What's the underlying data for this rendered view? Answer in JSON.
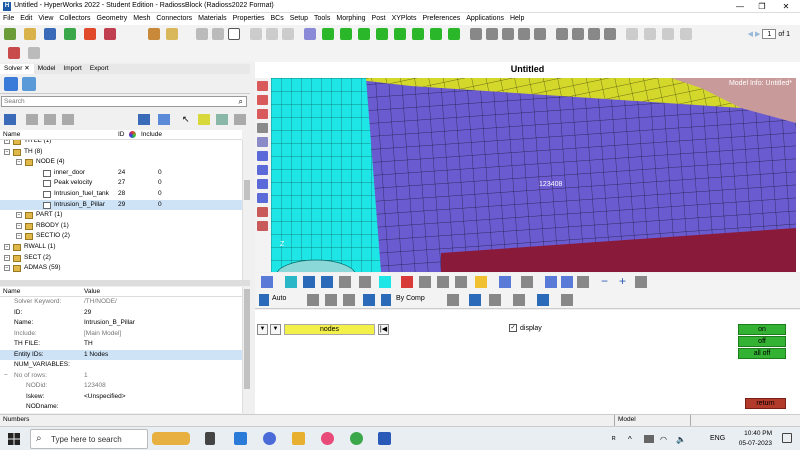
{
  "window": {
    "title": "Untitled - HyperWorks 2022 - Student Edition - RadiossBlock (Radioss2022 Format)",
    "minimize": "—",
    "maximize": "❐",
    "close": "✕"
  },
  "menu": [
    "File",
    "Edit",
    "View",
    "Collectors",
    "Geometry",
    "Mesh",
    "Connectors",
    "Materials",
    "Properties",
    "BCs",
    "Setup",
    "Tools",
    "Morphing",
    "Post",
    "XYPlots",
    "Preferences",
    "Applications",
    "Help"
  ],
  "toolbar": {
    "page_current": "1",
    "page_total_label": "of 1"
  },
  "left_tabs": [
    "Solver ✕",
    "Model",
    "Import",
    "Export"
  ],
  "search": {
    "placeholder": "Search"
  },
  "tree": {
    "headers": {
      "name": "Name",
      "id": "ID",
      "include": "Include"
    },
    "rows": [
      {
        "label": "TITLE (1)",
        "id": "",
        "include": ""
      },
      {
        "label": "TH (8)",
        "id": "",
        "include": ""
      },
      {
        "label": "NODE (4)",
        "id": "",
        "include": ""
      },
      {
        "label": "inner_door",
        "id": "24",
        "include": "0"
      },
      {
        "label": "Peak velocity",
        "id": "27",
        "include": "0"
      },
      {
        "label": "Intrusion_fuel_tank",
        "id": "28",
        "include": "0"
      },
      {
        "label": "Intrusion_B_Pillar",
        "id": "29",
        "include": "0"
      },
      {
        "label": "PART (1)",
        "id": "",
        "include": ""
      },
      {
        "label": "RBODY (1)",
        "id": "",
        "include": ""
      },
      {
        "label": "SECTIO (2)",
        "id": "",
        "include": ""
      },
      {
        "label": "RWALL (1)",
        "id": "",
        "include": ""
      },
      {
        "label": "SECT (2)",
        "id": "",
        "include": ""
      },
      {
        "label": "ADMAS (59)",
        "id": "",
        "include": ""
      }
    ]
  },
  "props": {
    "headers": {
      "name": "Name",
      "value": "Value"
    },
    "rows": [
      {
        "key": "Solver Keyword:",
        "value": "/TH/NODE/"
      },
      {
        "key": "ID:",
        "value": "29"
      },
      {
        "key": "Name:",
        "value": "Intrusion_B_Pillar"
      },
      {
        "key": "Include:",
        "value": "[Main Model]"
      },
      {
        "key": "TH FILE:",
        "value": "TH"
      },
      {
        "key": "Entity IDs:",
        "value": "1 Nodes"
      },
      {
        "key": "NUM_VARIABLES:",
        "value": ""
      },
      {
        "key": "No of rows:",
        "value": "1"
      },
      {
        "key": "NODid:",
        "value": "123408"
      },
      {
        "key": "Iskew:",
        "value": "<Unspecified>"
      },
      {
        "key": "NODname:",
        "value": ""
      }
    ]
  },
  "viewport": {
    "title": "Untitled",
    "model_info": "Model Info: Untitled*",
    "node_label": "123408"
  },
  "toolbar_lower": {
    "auto_label": "Auto",
    "bycomp_label": "By Comp"
  },
  "panel": {
    "nodes_label": "nodes",
    "display_label": "display",
    "on_label": "on",
    "off_label": "off",
    "alloff_label": "all off",
    "return_label": "return"
  },
  "status": {
    "left": "Numbers",
    "model": "Model"
  },
  "taskbar": {
    "search_placeholder": "Type here to search",
    "lang": "ENG",
    "time": "10:40 PM",
    "date": "05-07-2023"
  },
  "colors": {
    "mesh_purple": "#6b5bd1",
    "mesh_cyan": "#1ee6e6",
    "mesh_yellow": "#d4d82a",
    "mesh_pink": "#c89a9a",
    "mesh_maroon": "#8a1a3a",
    "button_green": "#33b233",
    "button_red": "#b23a2a",
    "field_yellow": "#f4f04a"
  }
}
